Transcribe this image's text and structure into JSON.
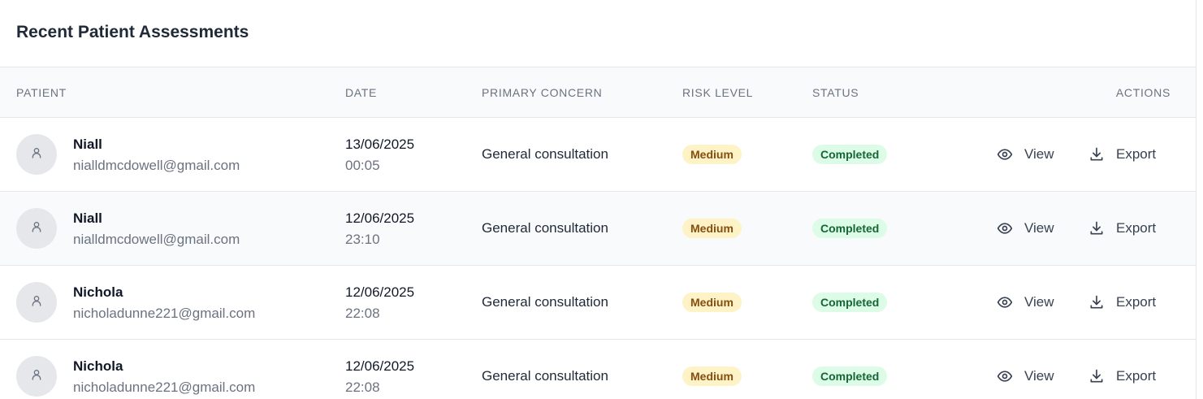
{
  "panel": {
    "title": "Recent Patient Assessments"
  },
  "columns": {
    "patient": "Patient",
    "date": "Date",
    "concern": "Primary Concern",
    "risk": "Risk Level",
    "status": "Status",
    "actions": "Actions"
  },
  "actions": {
    "view": "View",
    "export": "Export"
  },
  "colors": {
    "risk_medium_bg": "#fef3c7",
    "risk_medium_text": "#854d0e",
    "status_completed_bg": "#dcfce7",
    "status_completed_text": "#166534"
  },
  "rows": [
    {
      "name": "Niall",
      "email": "nialldmcdowell@gmail.com",
      "date": "13/06/2025",
      "time": "00:05",
      "concern": "General consultation",
      "risk": "Medium",
      "status": "Completed"
    },
    {
      "name": "Niall",
      "email": "nialldmcdowell@gmail.com",
      "date": "12/06/2025",
      "time": "23:10",
      "concern": "General consultation",
      "risk": "Medium",
      "status": "Completed"
    },
    {
      "name": "Nichola",
      "email": "nicholadunne221@gmail.com",
      "date": "12/06/2025",
      "time": "22:08",
      "concern": "General consultation",
      "risk": "Medium",
      "status": "Completed"
    },
    {
      "name": "Nichola",
      "email": "nicholadunne221@gmail.com",
      "date": "12/06/2025",
      "time": "22:08",
      "concern": "General consultation",
      "risk": "Medium",
      "status": "Completed"
    }
  ]
}
